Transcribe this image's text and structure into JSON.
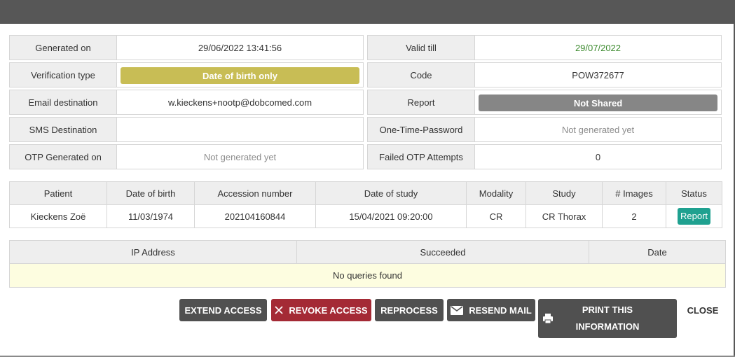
{
  "details": {
    "generated_on": {
      "label": "Generated on",
      "value": "29/06/2022 13:41:56"
    },
    "valid_till": {
      "label": "Valid till",
      "value": "29/07/2022"
    },
    "verification_type": {
      "label": "Verification type",
      "value": "Date of birth only"
    },
    "code": {
      "label": "Code",
      "value": "POW372677"
    },
    "email_destination": {
      "label": "Email destination",
      "value": "w.kieckens+nootp@dobcomed.com"
    },
    "report": {
      "label": "Report",
      "value": "Not Shared"
    },
    "sms_destination": {
      "label": "SMS Destination",
      "value": ""
    },
    "one_time_password": {
      "label": "One-Time-Password",
      "value": "Not generated yet"
    },
    "otp_generated_on": {
      "label": "OTP Generated on",
      "value": "Not generated yet"
    },
    "failed_otp_attempts": {
      "label": "Failed OTP Attempts",
      "value": "0"
    }
  },
  "colors": {
    "verification_pill": "#c8bd55",
    "report_pill": "#868686",
    "valid_till_text": "#3c8a2e",
    "report_button": "#1fa190",
    "revoke_button": "#a42a35"
  },
  "study_table": {
    "headers": [
      "Patient",
      "Date of birth",
      "Accession number",
      "Date of study",
      "Modality",
      "Study",
      "# Images",
      "Status"
    ],
    "rows": [
      {
        "patient": "Kieckens Zoë",
        "date_of_birth": "11/03/1974",
        "accession_number": "202104160844",
        "date_of_study": "15/04/2021 09:20:00",
        "modality": "CR",
        "study": "CR Thorax",
        "images": "2",
        "status": "Report"
      }
    ]
  },
  "query_table": {
    "headers": [
      "IP Address",
      "Succeeded",
      "Date"
    ],
    "empty_message": "No queries found"
  },
  "actions": {
    "extend_access": "EXTEND ACCESS",
    "revoke_access": "REVOKE ACCESS",
    "reprocess": "REPROCESS",
    "resend_mail": "RESEND MAIL",
    "print_line1": "PRINT THIS",
    "print_line2": "INFORMATION",
    "close": "CLOSE"
  },
  "icons": {
    "revoke": "close-x-icon",
    "resend": "envelope-icon",
    "print": "printer-icon"
  }
}
